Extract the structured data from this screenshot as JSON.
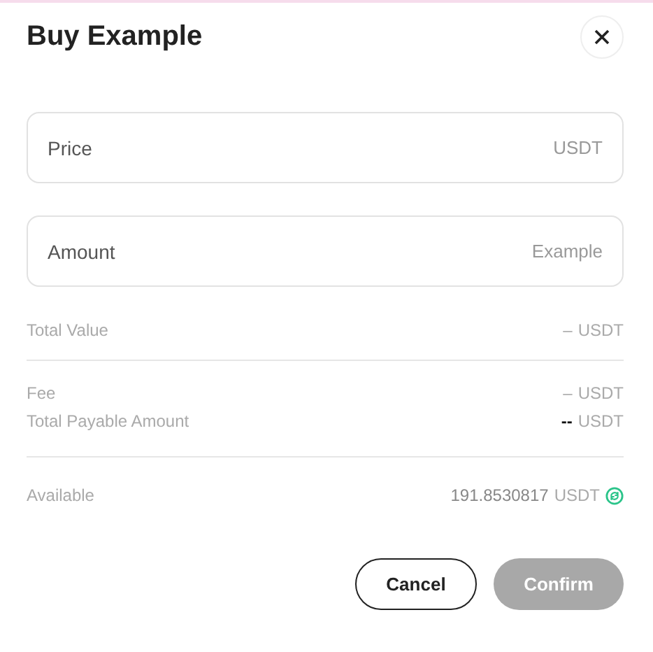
{
  "dialog": {
    "title": "Buy Example"
  },
  "fields": [
    {
      "label": "Price",
      "unit": "USDT"
    },
    {
      "label": "Amount",
      "unit": "Example"
    }
  ],
  "summary_groups": [
    [
      {
        "label": "Total Value",
        "value": "–",
        "unit": "USDT",
        "strong": false
      }
    ],
    [
      {
        "label": "Fee",
        "value": "–",
        "unit": "USDT",
        "strong": false
      },
      {
        "label": "Total Payable Amount",
        "value": "--",
        "unit": "USDT",
        "strong": true
      }
    ]
  ],
  "available": {
    "label": "Available",
    "value": "191.8530817",
    "unit": "USDT"
  },
  "buttons": [
    {
      "label": "Cancel",
      "kind": "secondary",
      "disabled": false
    },
    {
      "label": "Confirm",
      "kind": "primary",
      "disabled": true
    }
  ]
}
